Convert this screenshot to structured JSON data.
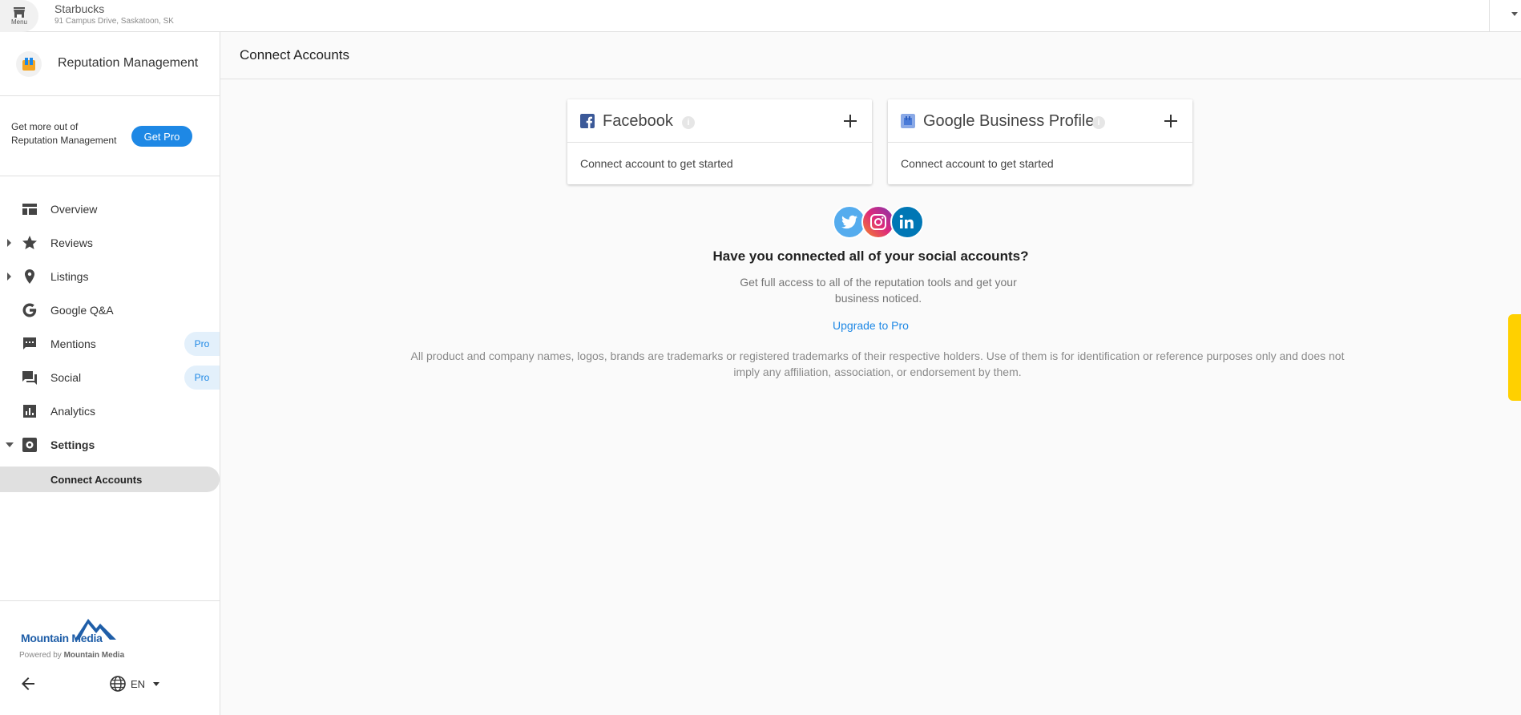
{
  "topbar": {
    "menu_label": "Menu",
    "business_name": "Starbucks",
    "business_address": "91 Campus Drive, Saskatoon, SK"
  },
  "sidebar": {
    "app_title": "Reputation Management",
    "promo_text": "Get more out of Reputation Management",
    "promo_button": "Get Pro",
    "items": [
      {
        "label": "Overview",
        "icon": "overview-icon"
      },
      {
        "label": "Reviews",
        "icon": "star-icon"
      },
      {
        "label": "Listings",
        "icon": "location-pin-icon"
      },
      {
        "label": "Google Q&A",
        "icon": "google-icon"
      },
      {
        "label": "Mentions",
        "icon": "comment-icon",
        "badge": "Pro"
      },
      {
        "label": "Social",
        "icon": "forum-icon",
        "badge": "Pro"
      },
      {
        "label": "Analytics",
        "icon": "analytics-icon"
      },
      {
        "label": "Settings",
        "icon": "settings-icon"
      }
    ],
    "sub_item": "Connect Accounts",
    "footer": {
      "brand": "Mountain Media",
      "powered_by": "Powered by",
      "powered_brand": "Mountain Media",
      "language": "EN"
    }
  },
  "main": {
    "page_title": "Connect Accounts",
    "cards": [
      {
        "title": "Facebook",
        "body": "Connect account to get started",
        "accent": "#3b5998"
      },
      {
        "title": "Google Business Profile",
        "body": "Connect account to get started",
        "accent": "#4a7bd8"
      }
    ],
    "question": "Have you connected all of your social accounts?",
    "subtext": "Get full access to all of the reputation tools and get your business noticed.",
    "upgrade_link": "Upgrade to Pro",
    "disclaimer": "All product and company names, logos, brands are trademarks or registered trademarks of their respective holders. Use of them is for identification or reference purposes only and does not imply any affiliation, association, or endorsement by them."
  },
  "colors": {
    "primary": "#1e88e5",
    "twitter": "#55acee",
    "linkedin": "#0077b5",
    "instagram": "#d62976"
  }
}
